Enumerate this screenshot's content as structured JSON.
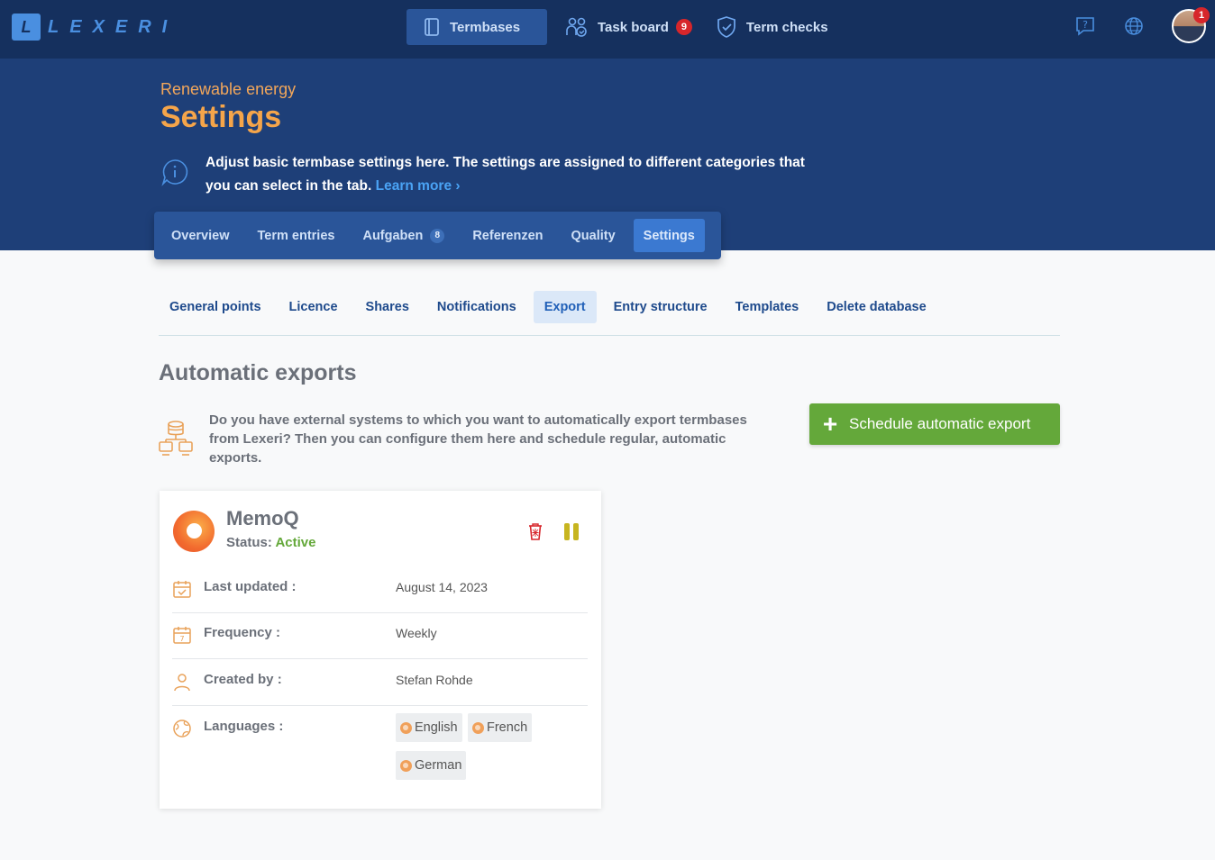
{
  "app": {
    "logo_text": "LEXERI",
    "nav": {
      "termbases": "Termbases",
      "task_board": "Task board",
      "task_board_badge": "9",
      "term_checks": "Term checks"
    },
    "avatar_badge": "1"
  },
  "header": {
    "breadcrumb": "Renewable energy",
    "title": "Settings",
    "info_text": "Adjust basic termbase settings here. The settings are assigned to different categories that you can select in the tab.",
    "learn_more": "Learn more"
  },
  "main_tabs": [
    {
      "label": "Overview"
    },
    {
      "label": "Term entries"
    },
    {
      "label": "Aufgaben",
      "badge": "8"
    },
    {
      "label": "Referenzen"
    },
    {
      "label": "Quality"
    },
    {
      "label": "Settings",
      "active": true
    }
  ],
  "sub_tabs": [
    {
      "label": "General points"
    },
    {
      "label": "Licence"
    },
    {
      "label": "Shares"
    },
    {
      "label": "Notifications"
    },
    {
      "label": "Export",
      "active": true
    },
    {
      "label": "Entry structure"
    },
    {
      "label": "Templates"
    },
    {
      "label": "Delete database"
    }
  ],
  "section": {
    "title": "Automatic exports",
    "intro": "Do you have external systems to which you want to automatically export termbases from Lexeri? Then you can configure them here and schedule regular, automatic exports.",
    "schedule_button": "Schedule automatic export"
  },
  "export_card": {
    "name": "MemoQ",
    "status_label": "Status:",
    "status_value": "Active",
    "rows": {
      "last_updated_label": "Last updated :",
      "last_updated_value": "August 14, 2023",
      "frequency_label": "Frequency :",
      "frequency_value": "Weekly",
      "created_by_label": "Created by :",
      "created_by_value": "Stefan Rohde",
      "languages_label": "Languages :"
    },
    "languages": [
      "English",
      "French",
      "German"
    ]
  },
  "colors": {
    "topbar": "#15305e",
    "header": "#1e3f78",
    "accent_orange": "#f5a54a",
    "link_blue": "#4aa3f5",
    "success_green": "#64a83a",
    "badge_red": "#d7262b"
  },
  "icons": [
    "help-icon",
    "globe-icon",
    "info-icon",
    "database-network-icon",
    "trash-icon",
    "pause-icon",
    "calendar-check-icon",
    "calendar-icon",
    "user-icon",
    "globe-outline-icon"
  ]
}
